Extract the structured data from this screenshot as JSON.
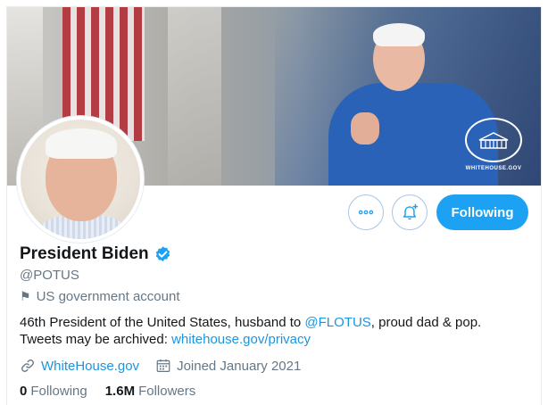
{
  "profile": {
    "name": "President Biden",
    "handle": "@POTUS",
    "label": "US government account",
    "bio_prefix": "46th President of the United States, husband to ",
    "bio_mention": "@FLOTUS",
    "bio_suffix": ", proud dad & pop.",
    "bio_line2_prefix": "Tweets may be archived: ",
    "bio_link": "whitehouse.gov/privacy",
    "website": "WhiteHouse.gov",
    "joined": "Joined January 2021"
  },
  "banner": {
    "logo_text": "WHITEHOUSE.GOV"
  },
  "actions": {
    "follow_label": "Following"
  },
  "stats": {
    "following_count": "0",
    "following_label": "Following",
    "followers_count": "1.6M",
    "followers_label": "Followers"
  },
  "icons": {
    "more": "more-icon",
    "notify": "bell-plus-icon",
    "verified": "verified-badge-icon",
    "label": "flag-icon",
    "link": "link-icon",
    "calendar": "calendar-icon"
  },
  "colors": {
    "accent": "#1da1f2",
    "link": "#1b95e0",
    "muted": "#657786"
  }
}
